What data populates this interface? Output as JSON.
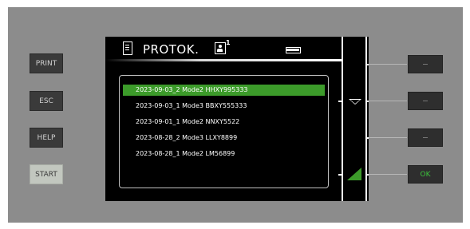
{
  "left_buttons": [
    {
      "label": "PRINT"
    },
    {
      "label": "ESC"
    },
    {
      "label": "HELP"
    },
    {
      "label": "START"
    }
  ],
  "screen": {
    "title": "PROTOK.",
    "user_number": "1",
    "icons": [
      "document-icon",
      "user-icon",
      "battery-icon"
    ]
  },
  "records": [
    {
      "text": "2023-09-03_2 Mode2 HHXY995333",
      "selected": true
    },
    {
      "text": "2023-09-03_1 Mode3 BBXY555333",
      "selected": false
    },
    {
      "text": "2023-09-01_1 Mode2 NNXY5522",
      "selected": false
    },
    {
      "text": "2023-08-28_2 Mode3 LLXY8899",
      "selected": false
    },
    {
      "text": "2023-08-28_1 Mode2 LM56899",
      "selected": false
    }
  ],
  "softkeys": [
    {
      "symbol": "",
      "label": ""
    },
    {
      "symbol": "down-arrow-icon",
      "label": ""
    },
    {
      "symbol": "",
      "label": ""
    },
    {
      "symbol": "confirm-triangle-icon",
      "label": "OK"
    }
  ],
  "colors": {
    "panel": "#8c8c8c",
    "screen": "#000000",
    "accent_green": "#3c9b2a",
    "ok_text": "#3cc43c"
  }
}
